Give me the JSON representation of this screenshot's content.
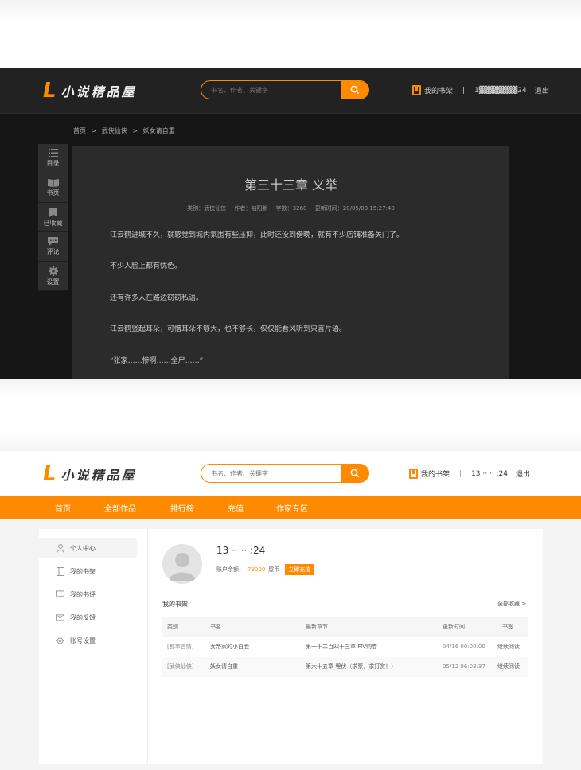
{
  "brand": {
    "logo_mark": "L",
    "logo_text": "小说精品屋",
    "accent": "#ff8a00"
  },
  "search": {
    "placeholder": "书名、作者、关键字"
  },
  "user_bar": {
    "bookshelf_label": "我的书架",
    "separator": "|",
    "username_dark": "1▓▓▓▓▓▓▓24",
    "username_light": "13  ··  ··  :24",
    "logout_label": "退出"
  },
  "reader": {
    "breadcrumb": [
      "首页",
      ">",
      "武侠仙侠",
      ">",
      "妖女请自重"
    ],
    "toolbar": [
      {
        "label": "目录",
        "icon": "list-icon"
      },
      {
        "label": "书页",
        "icon": "book-icon"
      },
      {
        "label": "已收藏",
        "icon": "bookmark-icon"
      },
      {
        "label": "评论",
        "icon": "comment-icon"
      },
      {
        "label": "设置",
        "icon": "gear-icon"
      }
    ],
    "chapter_title": "第三十三章 义举",
    "meta": {
      "category": "类别：武侠仙侠",
      "author": "作者：袖阳新",
      "words": "字数：3268",
      "updated": "更新时间：20/05/03 15:27:40"
    },
    "paragraphs": [
      "江云鹤进城不久，就感觉到城内氛围有些压抑，此时还没到傍晚，就有不少店铺准备关门了。",
      "不少人脸上都有忧色。",
      "还有许多人在路边窃窃私语。",
      "江云鹤竖起耳朵，可惜耳朵不够大，也不够长，仅仅能看风听到只言片语。",
      "“张家……惨啊……全尸……”"
    ]
  },
  "nav": {
    "items": [
      "首页",
      "全部作品",
      "排行榜",
      "充值",
      "作家专区"
    ]
  },
  "account": {
    "sidebar": [
      {
        "label": "个人中心",
        "icon": "user-icon",
        "active": true
      },
      {
        "label": "我的书架",
        "icon": "bookshelf-icon",
        "active": false
      },
      {
        "label": "我的书评",
        "icon": "comment-icon",
        "active": false
      },
      {
        "label": "我的反馈",
        "icon": "mail-icon",
        "active": false
      },
      {
        "label": "账号设置",
        "icon": "gear-icon",
        "active": false
      }
    ],
    "username": "13  ··  ··  :24",
    "balance_label": "账户余额：",
    "balance_value": "79000",
    "balance_unit": "屋币",
    "recharge_label": "立即充值",
    "shelf_title": "我的书架",
    "all_link": "全部收藏 >",
    "table": {
      "columns": [
        "类别",
        "书名",
        "最新章节",
        "更新时间",
        "书签"
      ],
      "rows": [
        [
          "[都市言情]",
          "女帝家的小白脸",
          "第一千二百四十三章 FIV购卷",
          "04/16 00:00:00",
          "继续阅读"
        ],
        [
          "[武侠仙侠]",
          "妖女请自重",
          "第六十五章 埋伏（求票，求打赏！）",
          "05/12 06:03:37",
          "继续阅读"
        ]
      ]
    }
  }
}
